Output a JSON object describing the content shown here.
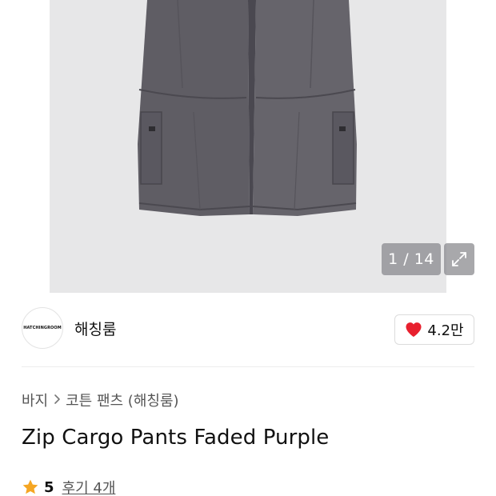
{
  "gallery": {
    "counter": "1 / 14",
    "expand_icon": "expand-arrows-icon"
  },
  "brand": {
    "logo_text": "HATCHINGROOM",
    "name": "해칭룸"
  },
  "like": {
    "icon": "heart-icon",
    "icon_color": "#e8202e",
    "count": "4.2만"
  },
  "breadcrumb": {
    "items": [
      "바지",
      "코튼 팬츠 (해칭룸)"
    ],
    "separator_icon": "chevron-right-icon"
  },
  "product": {
    "title": "Zip Cargo Pants Faded Purple"
  },
  "rating": {
    "icon": "star-icon",
    "icon_color": "#f5a623",
    "value": "5",
    "reviews_label": "후기 4개"
  }
}
